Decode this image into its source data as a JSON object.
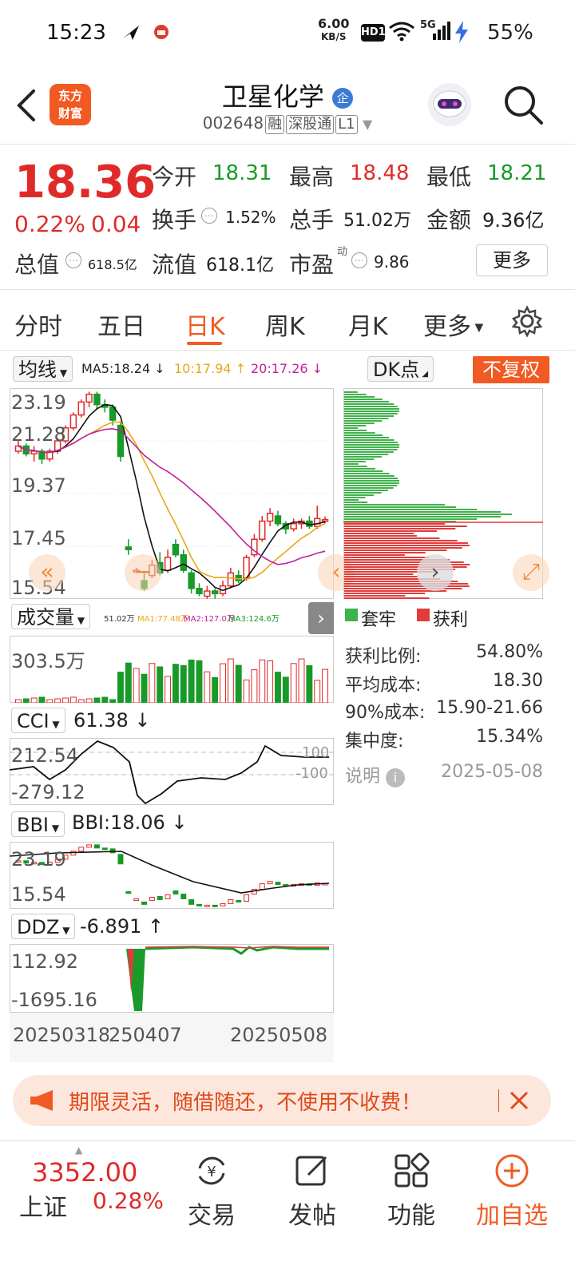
{
  "status_bar": {
    "time": "15:23",
    "net_speed": "6.00",
    "net_unit": "KB/S",
    "hd": "HD1",
    "signal": "5G",
    "battery": "55%"
  },
  "header": {
    "name": "卫星化学",
    "code": "002648",
    "tags": [
      "融",
      "深股通",
      "L1"
    ],
    "logo_line1": "东方",
    "logo_line2": "财富",
    "badge": "企"
  },
  "quote": {
    "price": "18.36",
    "change_pct": "0.22%",
    "change": "0.04",
    "open_label": "今开",
    "open": "18.31",
    "high_label": "最高",
    "high": "18.48",
    "low_label": "最低",
    "low": "18.21",
    "turnover_label": "换手",
    "turnover": "1.52%",
    "volume_label": "总手",
    "volume": "51.02万",
    "amount_label": "金额",
    "amount": "9.36亿",
    "mktcap_label": "总值",
    "mktcap": "618.5亿",
    "float_label": "流值",
    "float": "618.1亿",
    "pe_label": "市盈",
    "pe_sup": "动",
    "pe": "9.86",
    "more": "更多"
  },
  "tabs": [
    "分时",
    "五日",
    "日K",
    "周K",
    "月K",
    "更多"
  ],
  "active_tab": "日K",
  "kline": {
    "ma_selector": "均线",
    "ma5": "MA5:18.24",
    "ma10": "10:17.94",
    "ma20": "20:17.26",
    "dk": "DK点",
    "adjust": "不复权",
    "y_labels": [
      "23.19",
      "21.28",
      "19.37",
      "17.45",
      "15.54"
    ]
  },
  "volume": {
    "selector": "成交量",
    "legend": [
      "51.02万",
      "MA1:77.48万",
      "MA2:127.0万",
      "MA3:124.6万"
    ],
    "max": "303.5万"
  },
  "cci": {
    "selector": "CCI",
    "value": "61.38",
    "labels": [
      "212.54",
      "-279.12"
    ],
    "ref": [
      "100",
      "-100"
    ]
  },
  "bbi": {
    "selector": "BBI",
    "value": "BBI:18.06",
    "labels": [
      "23.19",
      "15.54"
    ]
  },
  "ddz": {
    "selector": "DDZ",
    "value": "-6.891",
    "labels": [
      "112.92",
      "-1695.16"
    ]
  },
  "dates": [
    "20250318",
    "250407",
    "20250508"
  ],
  "chips": {
    "legend_trapped": "套牢",
    "legend_profit": "获利",
    "rows": [
      {
        "label": "获利比例:",
        "value": "54.80%"
      },
      {
        "label": "平均成本:",
        "value": "18.30"
      },
      {
        "label": "90%成本:",
        "value": "15.90-21.66"
      },
      {
        "label": "集中度:",
        "value": "15.34%"
      }
    ],
    "note_label": "说明",
    "date": "2025-05-08"
  },
  "banner": {
    "text": "期限灵活，随借随还，不使用不收费！"
  },
  "bottom_nav": {
    "index_value": "3352.00",
    "index_name": "上证",
    "index_pct": "0.28%",
    "items": [
      "交易",
      "发帖",
      "功能",
      "加自选"
    ]
  },
  "colors": {
    "up": "#e02a2a",
    "down": "#179a28",
    "accent": "#f15a22"
  },
  "chart_data": {
    "type": "candlestick",
    "candles": [
      {
        "o": 21.0,
        "c": 21.2,
        "h": 21.4,
        "l": 20.9
      },
      {
        "o": 21.2,
        "c": 20.9,
        "h": 21.3,
        "l": 20.8
      },
      {
        "o": 20.9,
        "c": 21.0,
        "h": 21.2,
        "l": 20.6
      },
      {
        "o": 21.0,
        "c": 20.7,
        "h": 21.1,
        "l": 20.5
      },
      {
        "o": 20.7,
        "c": 21.0,
        "h": 21.1,
        "l": 20.6
      },
      {
        "o": 21.0,
        "c": 21.4,
        "h": 21.5,
        "l": 20.9
      },
      {
        "o": 21.4,
        "c": 21.9,
        "h": 22.0,
        "l": 21.3
      },
      {
        "o": 21.9,
        "c": 22.4,
        "h": 22.5,
        "l": 21.8
      },
      {
        "o": 22.4,
        "c": 22.9,
        "h": 23.0,
        "l": 22.3
      },
      {
        "o": 22.9,
        "c": 23.2,
        "h": 23.3,
        "l": 22.7
      },
      {
        "o": 23.2,
        "c": 22.8,
        "h": 23.3,
        "l": 22.6
      },
      {
        "o": 22.8,
        "c": 22.7,
        "h": 23.0,
        "l": 22.5
      },
      {
        "o": 22.7,
        "c": 22.2,
        "h": 22.8,
        "l": 22.0
      },
      {
        "o": 22.0,
        "c": 20.8,
        "h": 22.1,
        "l": 20.6
      },
      {
        "o": 17.3,
        "c": 17.2,
        "h": 17.6,
        "l": 17.0
      },
      {
        "o": 16.4,
        "c": 16.4,
        "h": 16.5,
        "l": 16.3
      },
      {
        "o": 16.0,
        "c": 15.7,
        "h": 16.3,
        "l": 15.6
      },
      {
        "o": 16.2,
        "c": 16.6,
        "h": 16.8,
        "l": 16.1
      },
      {
        "o": 16.7,
        "c": 16.3,
        "h": 17.1,
        "l": 16.2
      },
      {
        "o": 16.4,
        "c": 16.9,
        "h": 17.2,
        "l": 16.3
      },
      {
        "o": 17.4,
        "c": 17.0,
        "h": 17.6,
        "l": 16.9
      },
      {
        "o": 17.0,
        "c": 16.4,
        "h": 17.2,
        "l": 16.3
      },
      {
        "o": 16.3,
        "c": 15.7,
        "h": 16.4,
        "l": 15.5
      },
      {
        "o": 15.7,
        "c": 15.5,
        "h": 15.9,
        "l": 15.4
      },
      {
        "o": 15.4,
        "c": 15.6,
        "h": 15.8,
        "l": 15.3
      },
      {
        "o": 15.6,
        "c": 15.5,
        "h": 15.7,
        "l": 15.3
      },
      {
        "o": 15.5,
        "c": 15.8,
        "h": 16.0,
        "l": 15.4
      },
      {
        "o": 15.8,
        "c": 16.3,
        "h": 16.5,
        "l": 15.7
      },
      {
        "o": 16.2,
        "c": 16.0,
        "h": 16.4,
        "l": 15.9
      },
      {
        "o": 16.1,
        "c": 16.9,
        "h": 17.0,
        "l": 16.0
      },
      {
        "o": 17.0,
        "c": 17.6,
        "h": 17.8,
        "l": 16.9
      },
      {
        "o": 17.6,
        "c": 18.3,
        "h": 18.5,
        "l": 17.5
      },
      {
        "o": 18.3,
        "c": 18.6,
        "h": 18.8,
        "l": 18.1
      },
      {
        "o": 18.5,
        "c": 18.2,
        "h": 18.7,
        "l": 18.1
      },
      {
        "o": 18.2,
        "c": 18.0,
        "h": 18.3,
        "l": 17.8
      },
      {
        "o": 18.0,
        "c": 18.2,
        "h": 18.4,
        "l": 17.9
      },
      {
        "o": 18.2,
        "c": 18.3,
        "h": 18.4,
        "l": 18.0
      },
      {
        "o": 18.3,
        "c": 18.1,
        "h": 18.5,
        "l": 18.0
      },
      {
        "o": 18.1,
        "c": 18.4,
        "h": 18.9,
        "l": 18.0
      },
      {
        "o": 18.31,
        "c": 18.36,
        "h": 18.48,
        "l": 18.21
      }
    ],
    "ylim": [
      15.54,
      23.19
    ]
  }
}
